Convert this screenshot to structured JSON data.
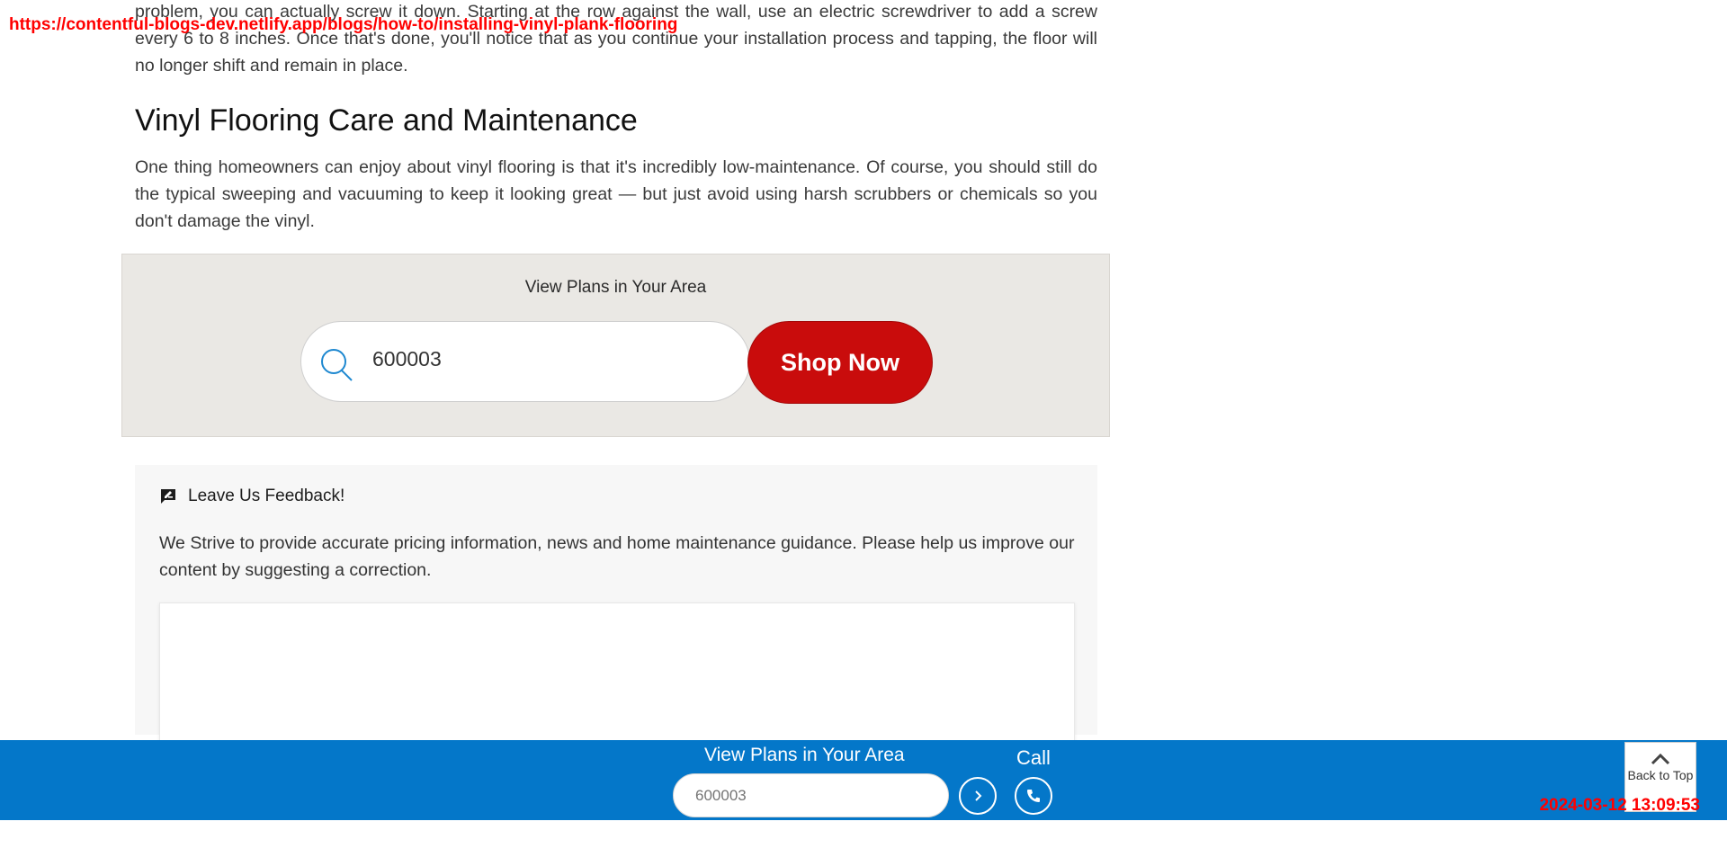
{
  "overlay": {
    "url": "https://contentful-blogs-dev.netlify.app/blogs/how-to/installing-vinyl-plank-flooring",
    "timestamp": "2024-03-12 13:09:53"
  },
  "article": {
    "intro_paragraph": "problem, you can actually screw it down. Starting at the row against the wall, use an electric screwdriver to add a screw every 6 to 8 inches. Once that's done, you'll notice that as you continue your installation process and tapping, the floor will no longer shift and remain in place.",
    "heading": "Vinyl Flooring Care and Maintenance",
    "care_paragraph": "One thing homeowners can enjoy about vinyl flooring is that it's incredibly low-maintenance. Of course, you should still do the typical sweeping and vacuuming to keep it looking great — but just avoid using harsh scrubbers or chemicals so you don't damage the vinyl."
  },
  "plans_widget": {
    "title": "View Plans in Your Area",
    "zip_value": "600003",
    "button_label": "Shop Now"
  },
  "feedback": {
    "title": "Leave Us Feedback!",
    "description": "We Strive to provide accurate pricing information, news and home maintenance guidance. Please help us improve our content by suggesting a correction."
  },
  "bottom_bar": {
    "title": "View Plans in Your Area",
    "zip_placeholder": "600003",
    "call_label": "Call",
    "back_to_top_label": "Back to Top"
  },
  "colors": {
    "accent_blue": "#0477c9",
    "shop_red": "#c90c0c",
    "widget_bg": "#eae8e4",
    "overlay_red": "#ff0000"
  },
  "icons": {
    "search": "search-icon",
    "feedback": "feedback-icon",
    "go": "chevron-right-icon",
    "call": "phone-icon",
    "back_to_top": "chevron-up-icon"
  }
}
